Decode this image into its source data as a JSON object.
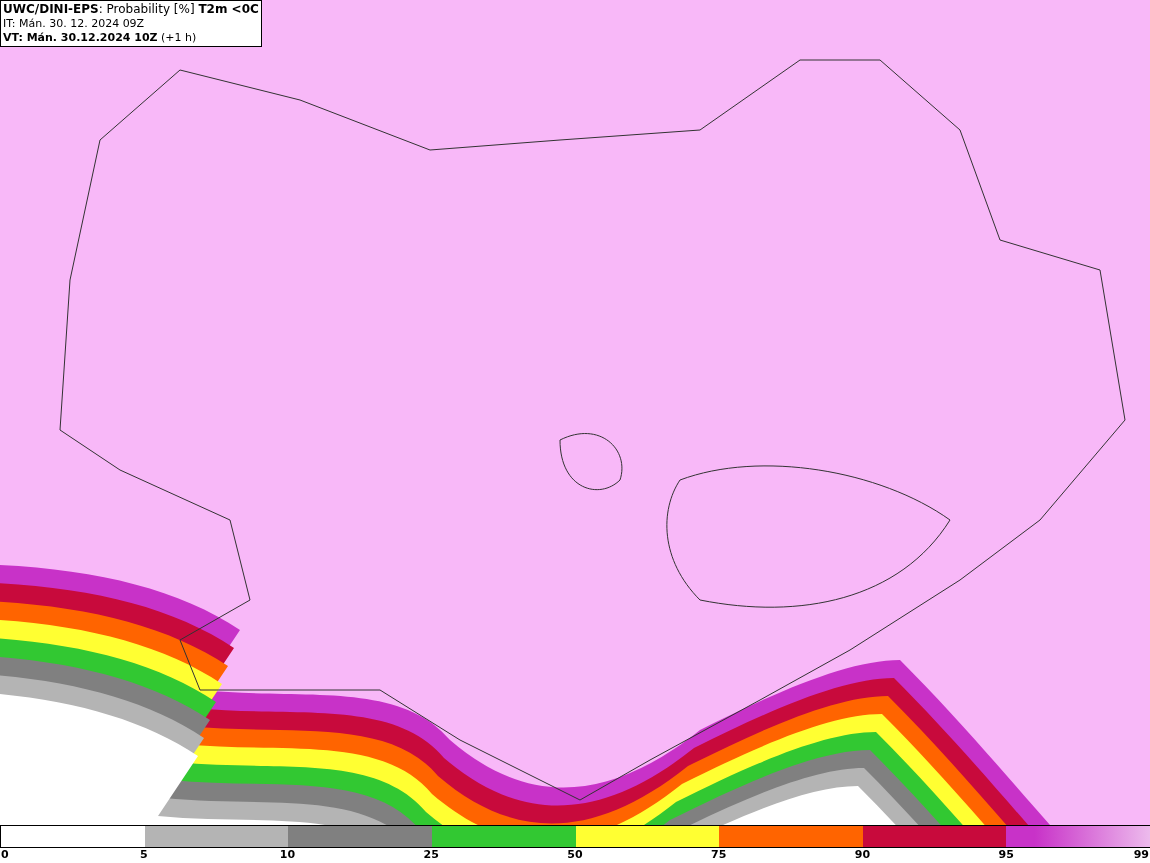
{
  "header": {
    "lines": [
      "**UWC/DINI-EPS**: Probability [%] **T2m <0C**",
      "IT: Mán. 30. 12. 2024 09Z",
      "**VT: Mán. 30.12.2024 10Z** (+1 h)"
    ]
  },
  "legend": {
    "segments": [
      {
        "color": "#ffffff"
      },
      {
        "color": "#b4b4b4"
      },
      {
        "color": "#808080"
      },
      {
        "color": "#32c832"
      },
      {
        "color": "#ffff32"
      },
      {
        "color": "#ff6400"
      },
      {
        "color": "#c80a3c"
      },
      {
        "color": "#c832c8",
        "kind": "gradient"
      }
    ],
    "labels": [
      "0",
      "5",
      "10",
      "25",
      "50",
      "75",
      "90",
      "95",
      "99"
    ]
  }
}
